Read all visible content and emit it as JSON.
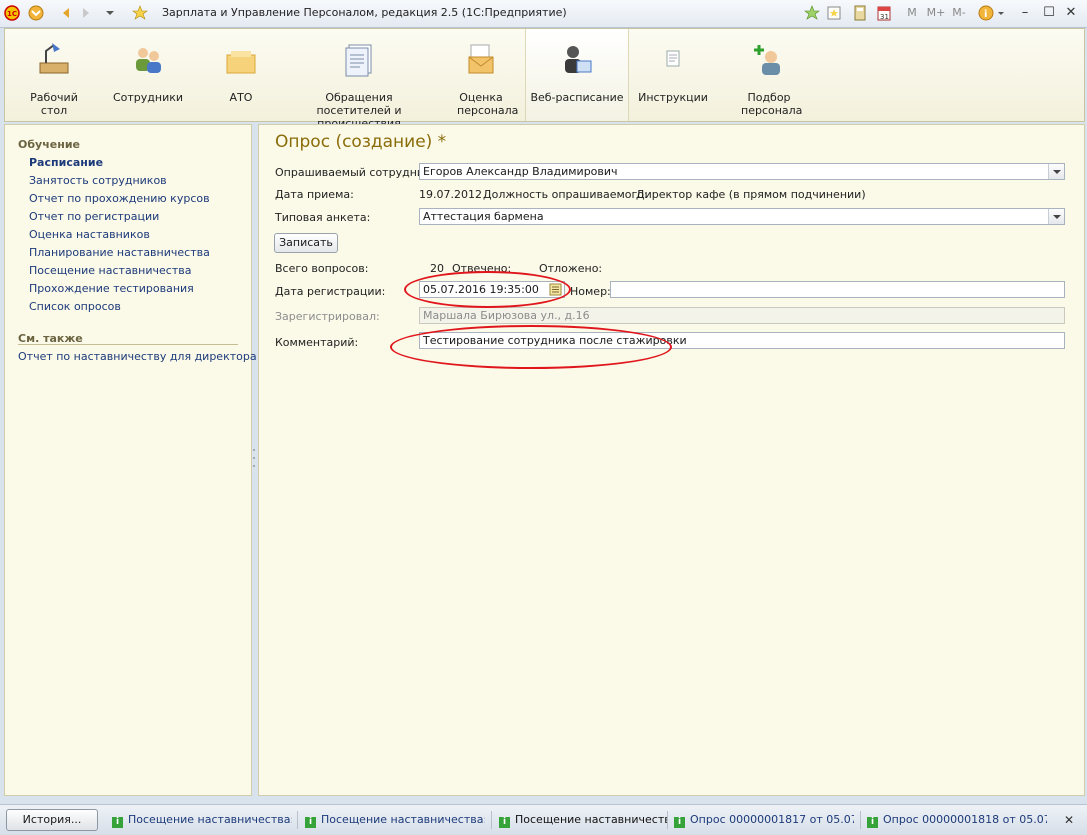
{
  "window": {
    "title": "Зарплата и Управление Персоналом, редакция 2.5  (1С:Предприятие)",
    "right_controls": [
      "M",
      "M+",
      "M-"
    ]
  },
  "toolbar": {
    "items": [
      {
        "label": "Рабочий стол",
        "icon": "desk-lamp-icon"
      },
      {
        "label": "Сотрудники",
        "icon": "employees-icon"
      },
      {
        "label": "АТО",
        "icon": "ato-icon"
      },
      {
        "label": "Обращения посетителей и происшествия",
        "icon": "document-stack-icon"
      },
      {
        "label": "Оценка персонала",
        "icon": "envelope-icon"
      },
      {
        "label": "Веб-расписание",
        "icon": "web-schedule-icon",
        "active": true
      },
      {
        "label": "Инструкции",
        "icon": "instructions-icon"
      },
      {
        "label": "Подбор персонала",
        "icon": "add-person-icon"
      }
    ]
  },
  "sidebar": {
    "section1_title": "Обучение",
    "items": [
      {
        "label": "Расписание",
        "bold": true
      },
      {
        "label": "Занятость сотрудников"
      },
      {
        "label": "Отчет по прохождению курсов"
      },
      {
        "label": "Отчет по регистрации"
      },
      {
        "label": "Оценка наставников"
      },
      {
        "label": "Планирование наставничества"
      },
      {
        "label": "Посещение наставничества"
      },
      {
        "label": "Прохождение тестирования"
      },
      {
        "label": "Список опросов"
      }
    ],
    "section2_title": "См. также",
    "see_also": [
      "Отчет по наставничеству для директора"
    ]
  },
  "form": {
    "title": "Опрос (создание) *",
    "employee_label": "Опрашиваемый сотрудник:",
    "employee_value": "Егоров Александр Владимирович",
    "hire_date_label": "Дата приема:",
    "hire_date_value": "19.07.2012",
    "position_label": "Должность опрашиваемого:",
    "position_value": "Директор кафе (в прямом подчинении)",
    "template_label": "Типовая анкета:",
    "template_value": "Аттестация бармена",
    "save_button": "Записать",
    "total_questions_label": "Всего вопросов:",
    "total_questions_value": "20",
    "answered_label": "Отвечено:",
    "postponed_label": "Отложено:",
    "reg_date_label": "Дата регистрации:",
    "reg_date_value": "05.07.2016 19:35:00",
    "number_label": "Номер:",
    "number_value": "",
    "registered_by_label": "Зарегистрировал:",
    "registered_by_value": "Маршала Бирюзова ул., д.16",
    "comment_label": "Комментарий:",
    "comment_value": "Тестирование сотрудника после стажировки"
  },
  "taskbar": {
    "history_button": "История...",
    "tasks": [
      {
        "label": "Посещение наставничества:..."
      },
      {
        "label": "Посещение наставничества:..."
      },
      {
        "label": "Посещение наставничества",
        "active": true
      },
      {
        "label": "Опрос 00000001817 от 05.07...."
      },
      {
        "label": "Опрос 00000001818 от 05.07...."
      }
    ]
  },
  "colors": {
    "form_title": "#8a6d0a",
    "link": "#1c3a7a",
    "highlight_oval": "#e0161c"
  }
}
